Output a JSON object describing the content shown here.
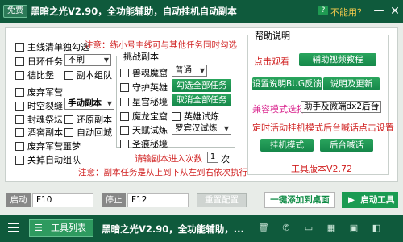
{
  "titlebar": {
    "badge": "免费",
    "title": "黑暗之光V2.90，全功能辅助，自动挂机自动副本",
    "unusable": "不能用？",
    "help_icon": "question-icon",
    "min_icon": "minimize-icon",
    "close_icon": "close-icon"
  },
  "left": {
    "main_task": "主线清单独勾选",
    "note_top": "注意：练小号主线可与其他任务同时勾选",
    "daily": "日环任务",
    "daily_select": "不刷",
    "debi": "德比堡",
    "sub_dungeon": "副本组队",
    "abandon_army": "废弃军营",
    "spacetime": "时空裂缝",
    "spacetime_select": "手动副本",
    "seal": "封魂祭坛",
    "original": "还原副本",
    "tavern": "酒窖副本",
    "auto_return": "自动回城",
    "abandon_army2": "废弃军营噩梦",
    "close_team": "关掉自动组队"
  },
  "challenge": {
    "title": "挑战副本",
    "beast": "兽魂魔窟",
    "beast_select": "普通",
    "guard": "守护英雄",
    "guard_btn": "勾选全部任务",
    "star": "星宫秘境",
    "star_btn": "取消全部任务",
    "dragon": "魔龙宝窟",
    "hero_trial": "英雄试炼",
    "sky": "天赋试炼",
    "sky_select": "罗宾汉试炼",
    "holy": "圣痕秘境",
    "enter_label": "请输副本进入次数",
    "enter_value": "1",
    "enter_unit": "次",
    "note_bottom": "注意：副本任务是从上到下从左到右依次执行"
  },
  "help": {
    "title": "帮助说明",
    "watch": "点击观看",
    "video_btn": "辅助视频教程",
    "bug_btn": "设置说明BUG反馈",
    "update_btn": "说明及更新",
    "compat_label": "兼容模式选择",
    "compat_select": "助手及微端dx2后台",
    "timer_note": "定时活动挂机模式后台喊话点击设置",
    "afk_btn": "挂机模式",
    "shout_btn": "后台喊话",
    "version": "工具版本V2.72"
  },
  "hotkeys": {
    "start_label": "启动",
    "start_key": "F10",
    "stop_label": "停止",
    "stop_key": "F12",
    "reset": "重置配置",
    "add_desktop": "一键添加到桌面",
    "start_tool": "启动工具"
  },
  "taskbar": {
    "menu_icon": "menu-icon",
    "tool_list": "工具列表",
    "title": "黑暗之光V2.90，全功能辅助，...",
    "icons": [
      "trash-icon",
      "phone-icon",
      "folder-icon",
      "chart-icon",
      "window-icon",
      "bag-icon"
    ]
  },
  "colors": {
    "brand": "#0f5a3c",
    "accent": "#1a9b52",
    "warn": "#d01f1f"
  }
}
